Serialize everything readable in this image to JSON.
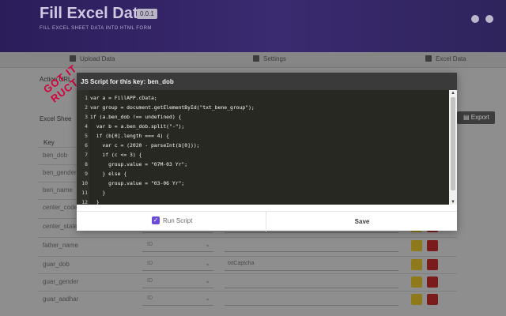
{
  "app": {
    "title": "Fill Excel Data",
    "version": "0.0.1",
    "subtitle": "FILL EXCEL SHEET DATA INTO HTML FORM",
    "tabs": [
      {
        "label": "Upload Data"
      },
      {
        "label": "Settings"
      },
      {
        "label": "Excel Data"
      }
    ],
    "action_url_label": "Action URL",
    "excel_sheet_label": "Excel Shee",
    "key_label": "Key",
    "export_label": "Export",
    "stamp": "GOT IT RUCT"
  },
  "rows": [
    {
      "key": "ben_dob",
      "select": "",
      "field": ""
    },
    {
      "key": "ben_gender",
      "select": "",
      "field": ""
    },
    {
      "key": "ben_name",
      "select": "",
      "field": ""
    },
    {
      "key": "center_code",
      "select": "",
      "field": ""
    },
    {
      "key": "center_state",
      "select": "",
      "field": ""
    },
    {
      "key": "father_name",
      "select": "ID",
      "field": ""
    },
    {
      "key": "guar_dob",
      "select": "ID",
      "field": "txtCaptcha"
    },
    {
      "key": "guar_gender",
      "select": "ID",
      "field": ""
    },
    {
      "key": "guar_aadhar",
      "select": "ID",
      "field": ""
    }
  ],
  "modal": {
    "title": "JS Script for this key: ben_dob",
    "code_lines": [
      {
        "n": "1",
        "text": "var a = FillAPP.cData;"
      },
      {
        "n": "2",
        "text": "var group = document.getElementById(\"txt_bene_group\");"
      },
      {
        "n": "3",
        "text": "if (a.ben_dob !== undefined) {"
      },
      {
        "n": "4",
        "text": "  var b = a.ben_dob.split(\"-\");"
      },
      {
        "n": "5",
        "text": "  if (b[0].length === 4) {"
      },
      {
        "n": "6",
        "text": "    var c = (2020 - parseInt(b[0]));"
      },
      {
        "n": "7",
        "text": "    if (c <= 3) {"
      },
      {
        "n": "8",
        "text": "      group.value = \"07M-03 Yr\";"
      },
      {
        "n": "9",
        "text": "    } else {"
      },
      {
        "n": "10",
        "text": "      group.value = \"03-06 Yr\";"
      },
      {
        "n": "11",
        "text": "    }"
      },
      {
        "n": "12",
        "text": "  }"
      }
    ],
    "run_script_label": "Run Script",
    "run_script_checked": true,
    "save_label": "Save"
  },
  "colors": {
    "accent": "#6c4bd8",
    "header_bar": "#3a3a3a",
    "editor_bg": "#272822"
  }
}
